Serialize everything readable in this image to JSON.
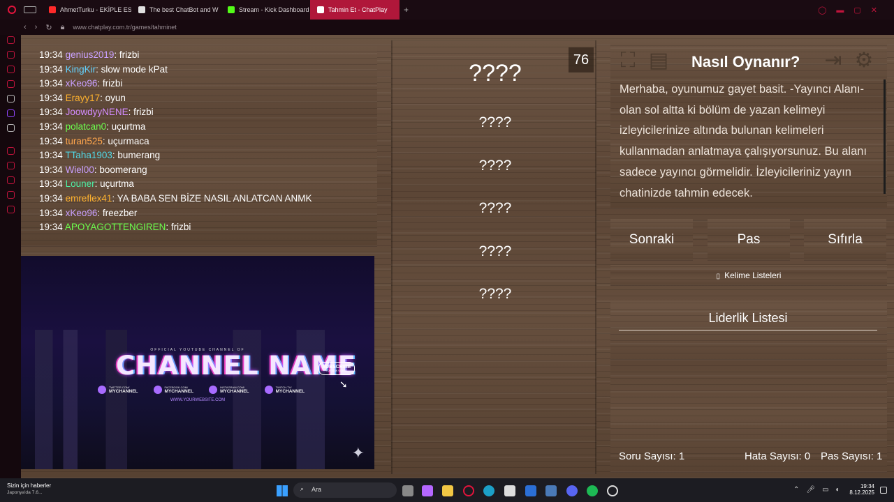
{
  "browser": {
    "tabs": [
      {
        "label": "AhmetTurku - EKİPLE ESK",
        "color": "#ff2a2a"
      },
      {
        "label": "The best ChatBot and W",
        "color": "#e0e0e0"
      },
      {
        "label": "Stream - Kick Dashboard",
        "color": "#53fc18"
      },
      {
        "label": "Tahmin Et - ChatPlay",
        "color": "#ffffff"
      }
    ],
    "url": "www.chatplay.com.tr/games/tahminet"
  },
  "chat": [
    {
      "time": "19:34",
      "user": "genius2019",
      "color": "#c9a0ff",
      "msg": "frizbi"
    },
    {
      "time": "19:34",
      "user": "KingKir",
      "color": "#62d2ff",
      "msg": "slow mode kPat"
    },
    {
      "time": "19:34",
      "user": "xKeo96",
      "color": "#c9a0ff",
      "msg": "frizbi"
    },
    {
      "time": "19:34",
      "user": "Erayy17",
      "color": "#ffb22e",
      "msg": "oyun"
    },
    {
      "time": "19:34",
      "user": "JoowdyyNENE",
      "color": "#d38cff",
      "msg": "frizbi"
    },
    {
      "time": "19:34",
      "user": "polatcan0",
      "color": "#6cff4e",
      "msg": "uçurtma"
    },
    {
      "time": "19:34",
      "user": "turan525",
      "color": "#ffa64d",
      "msg": "uçurmaca"
    },
    {
      "time": "19:34",
      "user": "TTaha1903",
      "color": "#4fd9e8",
      "msg": "bumerang"
    },
    {
      "time": "19:34",
      "user": "Wiel00",
      "color": "#c9a0ff",
      "msg": "boomerang"
    },
    {
      "time": "19:34",
      "user": "Louner",
      "color": "#4ef0a6",
      "msg": "uçurtma"
    },
    {
      "time": "19:34",
      "user": "emreflex41",
      "color": "#ffb22e",
      "msg": "YA BABA SEN BİZE NASIL ANLATCAN ANMK"
    },
    {
      "time": "19:34",
      "user": "xKeo96",
      "color": "#c9a0ff",
      "msg": "freezber"
    },
    {
      "time": "19:34",
      "user": "APOYAGOTTENGIREN",
      "color": "#6cff4e",
      "msg": "frizbi"
    }
  ],
  "overlay": {
    "small": "OFFICIAL YOUTUBE CHANNEL OF",
    "name": "CHANNEL NAME",
    "subscribe": "SUBSCRIBE",
    "subscribe_sub": "FOR NEW VIDEOS",
    "socials": [
      {
        "top": "TWITTER.COM/",
        "handle": "MYCHANNEL"
      },
      {
        "top": "FACEBOOK.COM/",
        "handle": "MYCHANNEL"
      },
      {
        "top": "INSTAGRAM.COM/",
        "handle": "MYCHANNEL"
      },
      {
        "top": "TWITCH.TV/",
        "handle": "MYCHANNEL"
      }
    ],
    "website": "WWW.YOURWEBSITE.COM"
  },
  "game": {
    "counter": "76",
    "words": [
      "????",
      "????",
      "????",
      "????",
      "????",
      "????"
    ]
  },
  "howto": {
    "title": "Nasıl Oynanır?",
    "text": "Merhaba, oyunumuz gayet basit. -Yayıncı Alanı- olan sol altta ki bölüm de yazan kelimeyi izleyicilerinize altında bulunan kelimeleri kullanmadan anlatmaya çalışıyorsunuz. Bu alanı sadece yayıncı görmelidir. İzleyicileriniz yayın chatinizde tahmin edecek."
  },
  "buttons": {
    "next": "Sonraki",
    "pass": "Pas",
    "reset": "Sıfırla",
    "word_lists": "Kelime Listeleri"
  },
  "leaderboard": {
    "title": "Liderlik Listesi",
    "question_count": "Soru Sayısı: 1",
    "error_count": "Hata Sayısı: 0",
    "pass_count": "Pas Sayısı: 1"
  },
  "taskbar": {
    "news_title": "Sizin için haberler",
    "news_sub": "Japonya'da 7.6...",
    "search": "Ara",
    "time": "19:34",
    "date": "8.12.2025"
  }
}
